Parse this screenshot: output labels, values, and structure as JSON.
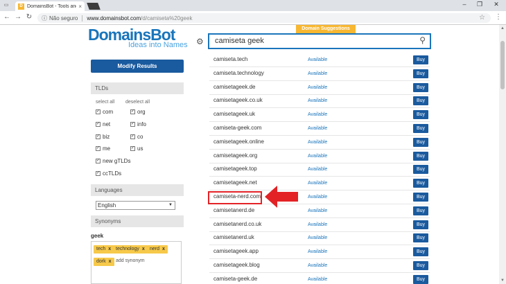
{
  "browser": {
    "tab_title": "DomainsBot - Tools and d",
    "tab_close": "×",
    "favicon": "D",
    "url_prefix": "Não seguro",
    "url_host": "www.domainsbot.com",
    "url_path": "/d/camiseta%20geek"
  },
  "logo": {
    "brand": "DomainsBot",
    "tagline": "Ideas into Names"
  },
  "sidebar": {
    "modify_label": "Modify Results",
    "tlds_title": "TLDs",
    "select_all": "select all",
    "deselect_all": "deselect all",
    "tlds": [
      {
        "label": "com",
        "checked": true
      },
      {
        "label": "org",
        "checked": true
      },
      {
        "label": "net",
        "checked": true
      },
      {
        "label": "info",
        "checked": true
      },
      {
        "label": "biz",
        "checked": true
      },
      {
        "label": "co",
        "checked": true
      },
      {
        "label": "me",
        "checked": true
      },
      {
        "label": "us",
        "checked": true
      },
      {
        "label": "new gTLDs",
        "checked": true
      },
      {
        "label": "ccTLDs",
        "checked": true
      }
    ],
    "languages_title": "Languages",
    "language_selected": "English",
    "synonyms_title": "Synonyms",
    "synonym_word": "geek",
    "synonyms": [
      "tech",
      "technology",
      "nerd",
      "dork"
    ],
    "add_synonym": "add synonym"
  },
  "search": {
    "value": "camiseta geek",
    "suggestions_tab": "Domain Suggestions"
  },
  "results": [
    {
      "domain": "camiseta.tech",
      "status": "Available",
      "action": "Buy"
    },
    {
      "domain": "camiseta.technology",
      "status": "Available",
      "action": "Buy"
    },
    {
      "domain": "camisetageek.de",
      "status": "Available",
      "action": "Buy"
    },
    {
      "domain": "camisetageek.co.uk",
      "status": "Available",
      "action": "Buy"
    },
    {
      "domain": "camisetageek.uk",
      "status": "Available",
      "action": "Buy"
    },
    {
      "domain": "camiseta-geek.com",
      "status": "Available",
      "action": "Buy"
    },
    {
      "domain": "camisetageek.online",
      "status": "Available",
      "action": "Buy"
    },
    {
      "domain": "camisetageek.org",
      "status": "Available",
      "action": "Buy"
    },
    {
      "domain": "camisetageek.top",
      "status": "Available",
      "action": "Buy"
    },
    {
      "domain": "camisetageek.net",
      "status": "Available",
      "action": "Buy"
    },
    {
      "domain": "camiseta-nerd.com",
      "status": "Available",
      "action": "Buy"
    },
    {
      "domain": "camisetanerd.de",
      "status": "Available",
      "action": "Buy"
    },
    {
      "domain": "camisetanerd.co.uk",
      "status": "Available",
      "action": "Buy"
    },
    {
      "domain": "camisetanerd.uk",
      "status": "Available",
      "action": "Buy"
    },
    {
      "domain": "camisetageek.app",
      "status": "Available",
      "action": "Buy"
    },
    {
      "domain": "camisetageek.blog",
      "status": "Available",
      "action": "Buy"
    },
    {
      "domain": "camiseta-geek.de",
      "status": "Available",
      "action": "Buy"
    }
  ],
  "colors": {
    "brand_blue": "#1a75bb",
    "button_blue": "#1a5a9e",
    "accent_yellow": "#f7b731",
    "highlight_red": "#e32226"
  }
}
